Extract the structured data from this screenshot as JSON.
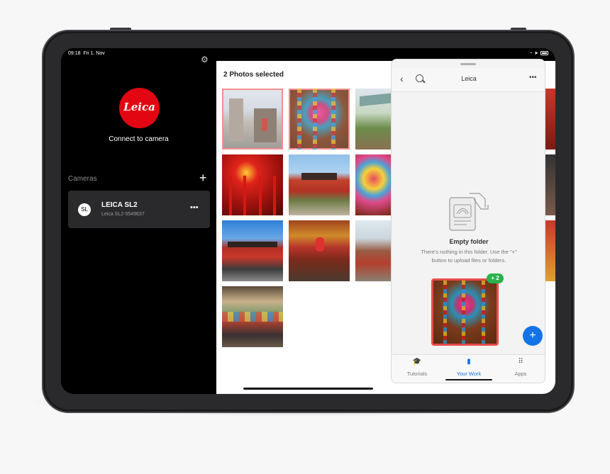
{
  "status_bar": {
    "time": "09:18",
    "date": "Fri 1. Nov"
  },
  "left_panel": {
    "logo_text": "Leica",
    "connect_label": "Connect to camera",
    "cameras_label": "Cameras",
    "add_label": "+",
    "camera": {
      "avatar": "SL",
      "name": "LEICA SL2",
      "serial": "Leica SL2-5549637",
      "more": "•••"
    }
  },
  "photos": {
    "selected_label": "2 Photos selected",
    "items": [
      {
        "selected": true
      },
      {
        "selected": true
      },
      {
        "selected": false
      },
      {
        "selected": false
      },
      {
        "selected": false
      },
      {
        "selected": false
      },
      {
        "selected": false
      },
      {
        "selected": false
      },
      {
        "selected": false
      },
      {
        "selected": false
      }
    ]
  },
  "cc_panel": {
    "title": "Leica",
    "back": "‹",
    "more": "•••",
    "empty_title": "Empty folder",
    "empty_description": "There's nothing in this folder. Use the \"+\" button to upload files or folders.",
    "drag_count": "+ 2",
    "fab": "+",
    "tabs": [
      {
        "label": "Tutorials",
        "icon": "graduation-cap-icon",
        "active": false
      },
      {
        "label": "Your Work",
        "icon": "document-icon",
        "active": true
      },
      {
        "label": "Apps",
        "icon": "apps-grid-icon",
        "active": false
      }
    ]
  },
  "colors": {
    "leica_red": "#e20612",
    "accent_blue": "#1473e6",
    "selection_red": "#f07c7c",
    "badge_green": "#2bb24c"
  }
}
